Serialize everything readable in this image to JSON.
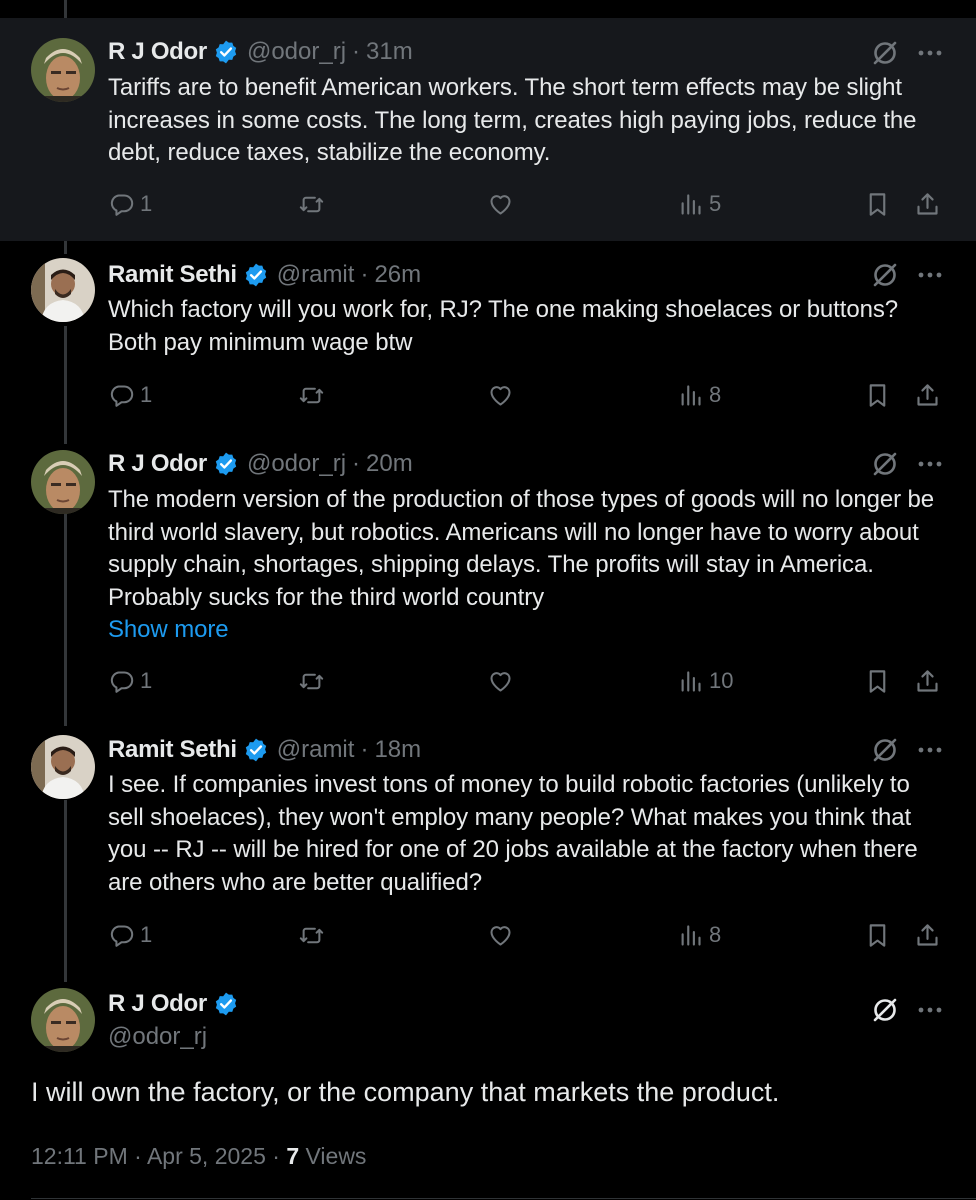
{
  "colors": {
    "background": "#000000",
    "highlight": "#16181c",
    "text": "#e7e9ea",
    "muted": "#71767b",
    "link": "#1d9bf0",
    "verified": "#1d9bf0"
  },
  "icons": {
    "reply": "speech-bubble",
    "repost": "two-arrows-loop",
    "like": "heart",
    "views": "bar-chart",
    "bookmark": "bookmark",
    "share": "upload-arrow",
    "grok": "slashed-circle",
    "more": "three-dots",
    "verified": "blue-badge-check"
  },
  "tweets": [
    {
      "name": "R J Odor",
      "handle": "@odor_rj",
      "sep": "·",
      "time": "31m",
      "text": "Tariffs are to benefit American workers. The short term effects may be slight increases in some costs. The long term, creates high paying jobs, reduce the debt, reduce taxes, stabilize the economy.",
      "replies": "1",
      "reposts": "",
      "likes": "",
      "views": "5"
    },
    {
      "name": "Ramit Sethi",
      "handle": "@ramit",
      "sep": "·",
      "time": "26m",
      "text": "Which factory will you work for, RJ? The one making shoelaces or buttons? Both pay minimum wage btw",
      "replies": "1",
      "reposts": "",
      "likes": "",
      "views": "8"
    },
    {
      "name": "R J Odor",
      "handle": "@odor_rj",
      "sep": "·",
      "time": "20m",
      "text": "The modern version of the production of those types of goods will no longer be third world slavery, but robotics. Americans will no longer have to worry about supply chain, shortages, shipping delays. The profits will stay in America. Probably sucks for the third world country",
      "show_more": "Show more",
      "replies": "1",
      "reposts": "",
      "likes": "",
      "views": "10"
    },
    {
      "name": "Ramit Sethi",
      "handle": "@ramit",
      "sep": "·",
      "time": "18m",
      "text": "I see. If companies invest tons of money to build robotic factories (unlikely to sell shoelaces), they won't employ many people? What makes you think that you -- RJ -- will be hired for one of 20 jobs available at the factory when there are others who are better qualified?",
      "replies": "1",
      "reposts": "",
      "likes": "",
      "views": "8"
    }
  ],
  "main_tweet": {
    "name": "R J Odor",
    "handle": "@odor_rj",
    "text": "I will own the factory, or the company that markets the product.",
    "time": "12:11 PM",
    "sep1": "·",
    "date": "Apr 5, 2025",
    "sep2": "·",
    "views_count": "7",
    "views_label": "Views"
  }
}
